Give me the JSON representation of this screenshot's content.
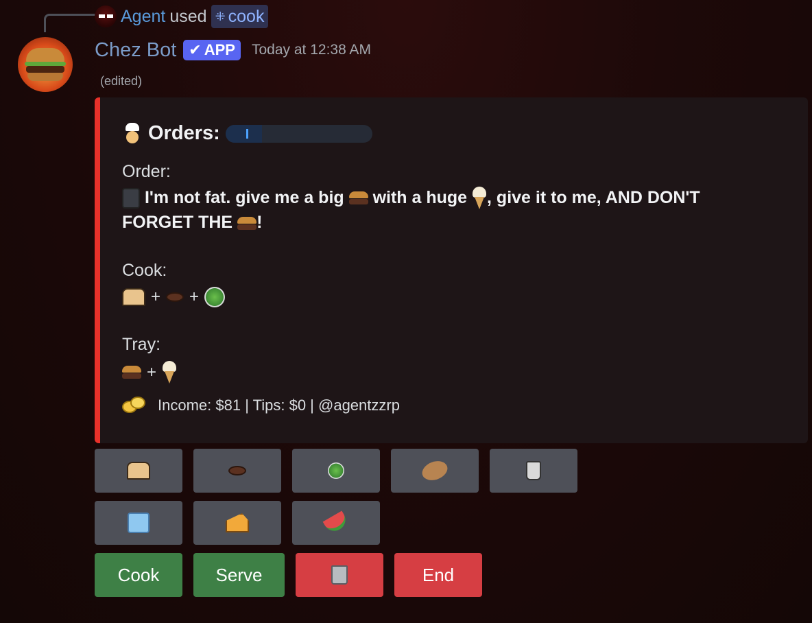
{
  "reply": {
    "user": "Agent",
    "used_text": "used",
    "command": "cook"
  },
  "message": {
    "author": "Chez Bot",
    "badge": "APP",
    "timestamp": "Today at 12:38 AM",
    "edited": "(edited)"
  },
  "embed": {
    "accent_color": "#e8312a",
    "title": "Orders:",
    "progress_fraction": 0.25,
    "order_label": "Order:",
    "order_text_1": "I'm not fat. give me a big",
    "order_text_2": "with a huge",
    "order_text_3": ", give it to me, AND DON'T FORGET THE",
    "order_text_4": "!",
    "cook_label": "Cook:",
    "cook_items": [
      "bread-icon",
      "meat-icon",
      "salad-icon"
    ],
    "tray_label": "Tray:",
    "tray_items": [
      "burger-icon",
      "ice-cream-icon"
    ],
    "plus": "+",
    "footer_text": "Income: $81 | Tips: $0 | @agentzzrp"
  },
  "ingredient_buttons": [
    {
      "icon": "bread-icon"
    },
    {
      "icon": "meat-icon"
    },
    {
      "icon": "salad-icon"
    },
    {
      "icon": "potato-icon"
    },
    {
      "icon": "cup-icon"
    },
    {
      "icon": "ice-icon"
    },
    {
      "icon": "cheese-icon"
    },
    {
      "icon": "watermelon-icon"
    }
  ],
  "actions": {
    "cook": "Cook",
    "serve": "Serve",
    "trash_icon": "trash-icon",
    "end": "End"
  },
  "colors": {
    "green": "#3e8046",
    "red": "#d63e43",
    "blurple": "#5865f2",
    "secondary": "#4e5058"
  }
}
